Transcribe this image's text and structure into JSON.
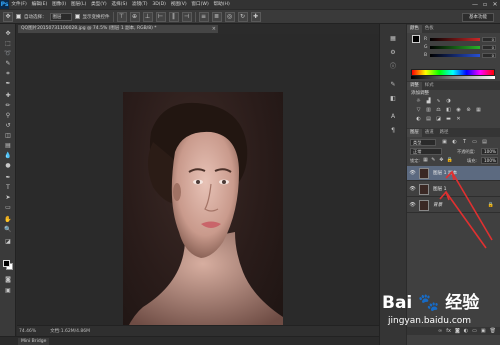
{
  "app": {
    "logo_text": "Ps"
  },
  "menubar": {
    "items": [
      "文件(F)",
      "编辑(E)",
      "图像(I)",
      "图层(L)",
      "类型(Y)",
      "选择(S)",
      "滤镜(T)",
      "3D(D)",
      "视图(V)",
      "窗口(W)",
      "帮助(H)"
    ],
    "window_controls": [
      "—",
      "▫",
      "✕"
    ]
  },
  "options_bar": {
    "auto_select_label": "自动选择：",
    "auto_select_value": "图层",
    "show_transform_label": "显示变换控件",
    "workspace": "基本功能"
  },
  "document_tab": {
    "title": "QQ图片20150731100028.jpg @ 74.5% (图层 1 副本, RGB/8) *",
    "close": "×"
  },
  "status_bar": {
    "zoom": "74.46%",
    "doc_info": "文档:1.62M/4.86M"
  },
  "mini_bridge": {
    "label": "Mini Bridge"
  },
  "panels": {
    "color": {
      "tabs": [
        "颜色",
        "色板"
      ],
      "sliders": [
        {
          "letter": "R",
          "value": "0",
          "track_color": "#c82828"
        },
        {
          "letter": "G",
          "value": "0",
          "track_color": "#28b428"
        },
        {
          "letter": "B",
          "value": "0",
          "track_color": "#2850d2"
        }
      ]
    },
    "adjustments": {
      "tabs": [
        "调整",
        "样式"
      ],
      "title": "添加调整"
    },
    "layers": {
      "tabs": [
        "图层",
        "通道",
        "路径"
      ],
      "kind_filter": "类型",
      "blend_mode": "正常",
      "opacity_label": "不透明度:",
      "opacity_value": "100%",
      "lock_label": "锁定:",
      "fill_label": "填充:",
      "fill_value": "100%",
      "layers": [
        {
          "name": "图层 1 副本",
          "selected": true,
          "locked": false
        },
        {
          "name": "图层 1",
          "selected": false,
          "locked": false
        },
        {
          "name": "背景",
          "selected": false,
          "locked": true
        }
      ]
    }
  },
  "watermark": {
    "logo": "Bai 🐾 经验",
    "url": "jingyan.baidu.com"
  },
  "colors": {
    "annotation_arrow": "#e03030",
    "selected_layer": "#5c6a80"
  }
}
